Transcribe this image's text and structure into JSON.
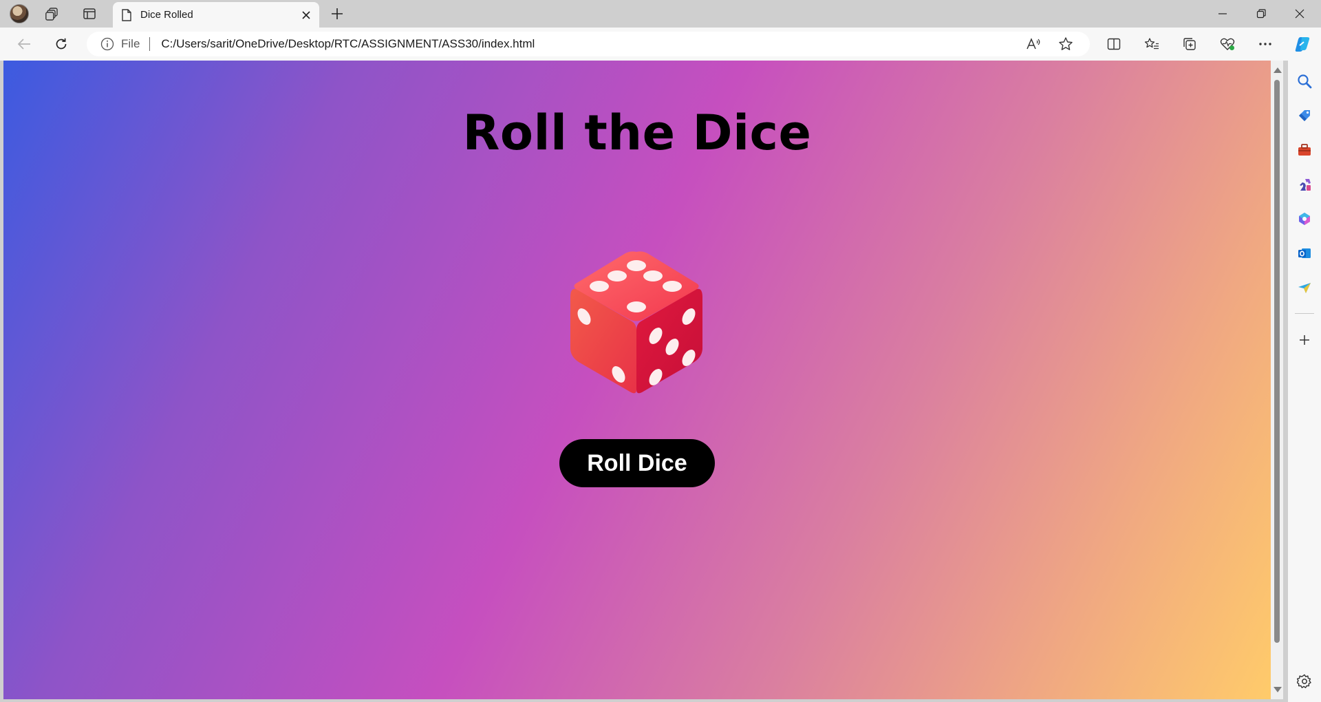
{
  "browser": {
    "tab": {
      "title": "Dice Rolled",
      "icon": "page-icon"
    },
    "address": {
      "info_label": "File",
      "url": "C:/Users/sarit/OneDrive/Desktop/RTC/ASSIGNMENT/ASS30/index.html"
    },
    "sidebar_icons": [
      "search-icon",
      "shopping-tag-icon",
      "tools-icon",
      "games-icon",
      "microsoft-365-icon",
      "outlook-icon",
      "send-icon",
      "add-icon",
      "settings-icon"
    ]
  },
  "page": {
    "heading": "Roll the Dice",
    "dice_face": "5",
    "button_label": "Roll Dice",
    "colors": {
      "gradient": [
        "#3c5be0",
        "#c64fbf",
        "#ffcb6a"
      ],
      "button_bg": "#000000",
      "button_text": "#ffffff",
      "die": "#e8344a"
    }
  }
}
